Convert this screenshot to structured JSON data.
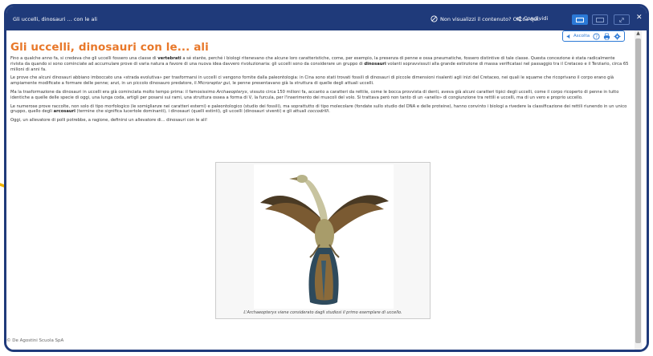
{
  "window": {
    "title": "Gli uccelli, dinosauri ... con le ali",
    "notify_label": "Non visualizzi il contenuto? Clicca qui.",
    "share_label": "Condividi"
  },
  "toolbar": {
    "listen_label": "Ascolta",
    "icons": [
      "help-icon",
      "print-icon",
      "settings-icon"
    ]
  },
  "article": {
    "title": "Gli uccelli, dinosauri con le... ali",
    "paragraphs": [
      {
        "parts": [
          {
            "t": "Fino a qualche anno fa, si credeva che gli uccelli fossero una classe di "
          },
          {
            "t": "vertebrati",
            "b": true
          },
          {
            "t": " a sé stante, perché i biologi ritenevano che alcune loro caratteristiche, come, per esempio, la presenza di penne e ossa pneumatiche, fossero distintive di tale classe. Questa concezione è stata radicalmente rivista da quando si sono cominciate ad accumulare prove di varia natura a favore di una nuova idea davvero rivoluzionaria: gli uccelli sono da considerare un gruppo di "
          },
          {
            "t": "dinosauri",
            "b": true
          },
          {
            "t": " volanti sopravvissuti alla grande estinzione di massa verificatasi nel passaggio tra il Cretaceo e il Terziario, circa 65 milioni di anni fa."
          }
        ]
      },
      {
        "parts": [
          {
            "t": "Le prove che alcuni dinosauri abbiano imboccato una «strada evolutiva» per trasformarsi in uccelli ci vengono fornite dalla paleontologia: in Cina sono stati trovati fossili di dinosauri di piccole dimensioni risalenti agli inizi del Cretaceo, nei quali le squame che ricoprivano il corpo erano già ampiamente modificate a formare delle penne; anzi, in un piccolo dinosauro predatore, il "
          },
          {
            "t": "Microraptor gui",
            "i": true
          },
          {
            "t": ", le penne presentavano già la struttura di quelle degli attuali uccelli."
          }
        ]
      },
      {
        "parts": [
          {
            "t": "Ma la trasformazione da dinosauri in uccelli era già cominciata molto tempo prima: il famosissimo "
          },
          {
            "t": "Archaeopteryx",
            "i": true
          },
          {
            "t": ", vissuto circa 150 milioni fa, accanto a caratteri da rettile, come le bocca provvista di denti, aveva già alcuni caratteri tipici degli uccelli, come il corpo ricoperto di penne in tutto identiche a quelle delle specie di oggi, una lunga coda, artigli per posarsi sui rami, una struttura ossea a forma di V, la furcula, per l'inserimento dei muscoli del volo. Si trattava però non tanto di un «anello» di congiunzione tra rettili e uccelli, ma di un vero e proprio uccello."
          }
        ]
      },
      {
        "parts": [
          {
            "t": "Le numerose prove raccolte, non solo di tipo morfologico (le somiglianze nei caratteri esterni) e paleontologico (studio dei fossili), ma soprattutto di tipo molecolare (fondate sullo studio del DNA e delle proteine), hanno convinto i biologi a rivedere la classificazione dei rettili riunendo in un unico gruppo, quello degli "
          },
          {
            "t": "arcosauri",
            "b": true
          },
          {
            "t": " (termine che significa lucertole dominanti), i dinosauri (quelli estinti), gli uccelli (dinosauri viventi) e gli attuali "
          },
          {
            "t": "coccodrilli",
            "i": true
          },
          {
            "t": "."
          }
        ]
      },
      {
        "parts": [
          {
            "t": "Oggi, un allevatore di polli potrebbe, a ragione, definirsi un allevatore di... dinosauri con le ali!"
          }
        ]
      }
    ]
  },
  "figure": {
    "caption": "L'Archaeopteryx viene considerato dagli studiosi il primo esemplare di uccello."
  },
  "footer": {
    "copyright": "© De Agostini Scuola SpA"
  },
  "colors": {
    "frame": "#1f3a7a",
    "accent": "#e8782a",
    "highlight_arrow": "#f2b400",
    "active_button": "#2b79d6"
  }
}
